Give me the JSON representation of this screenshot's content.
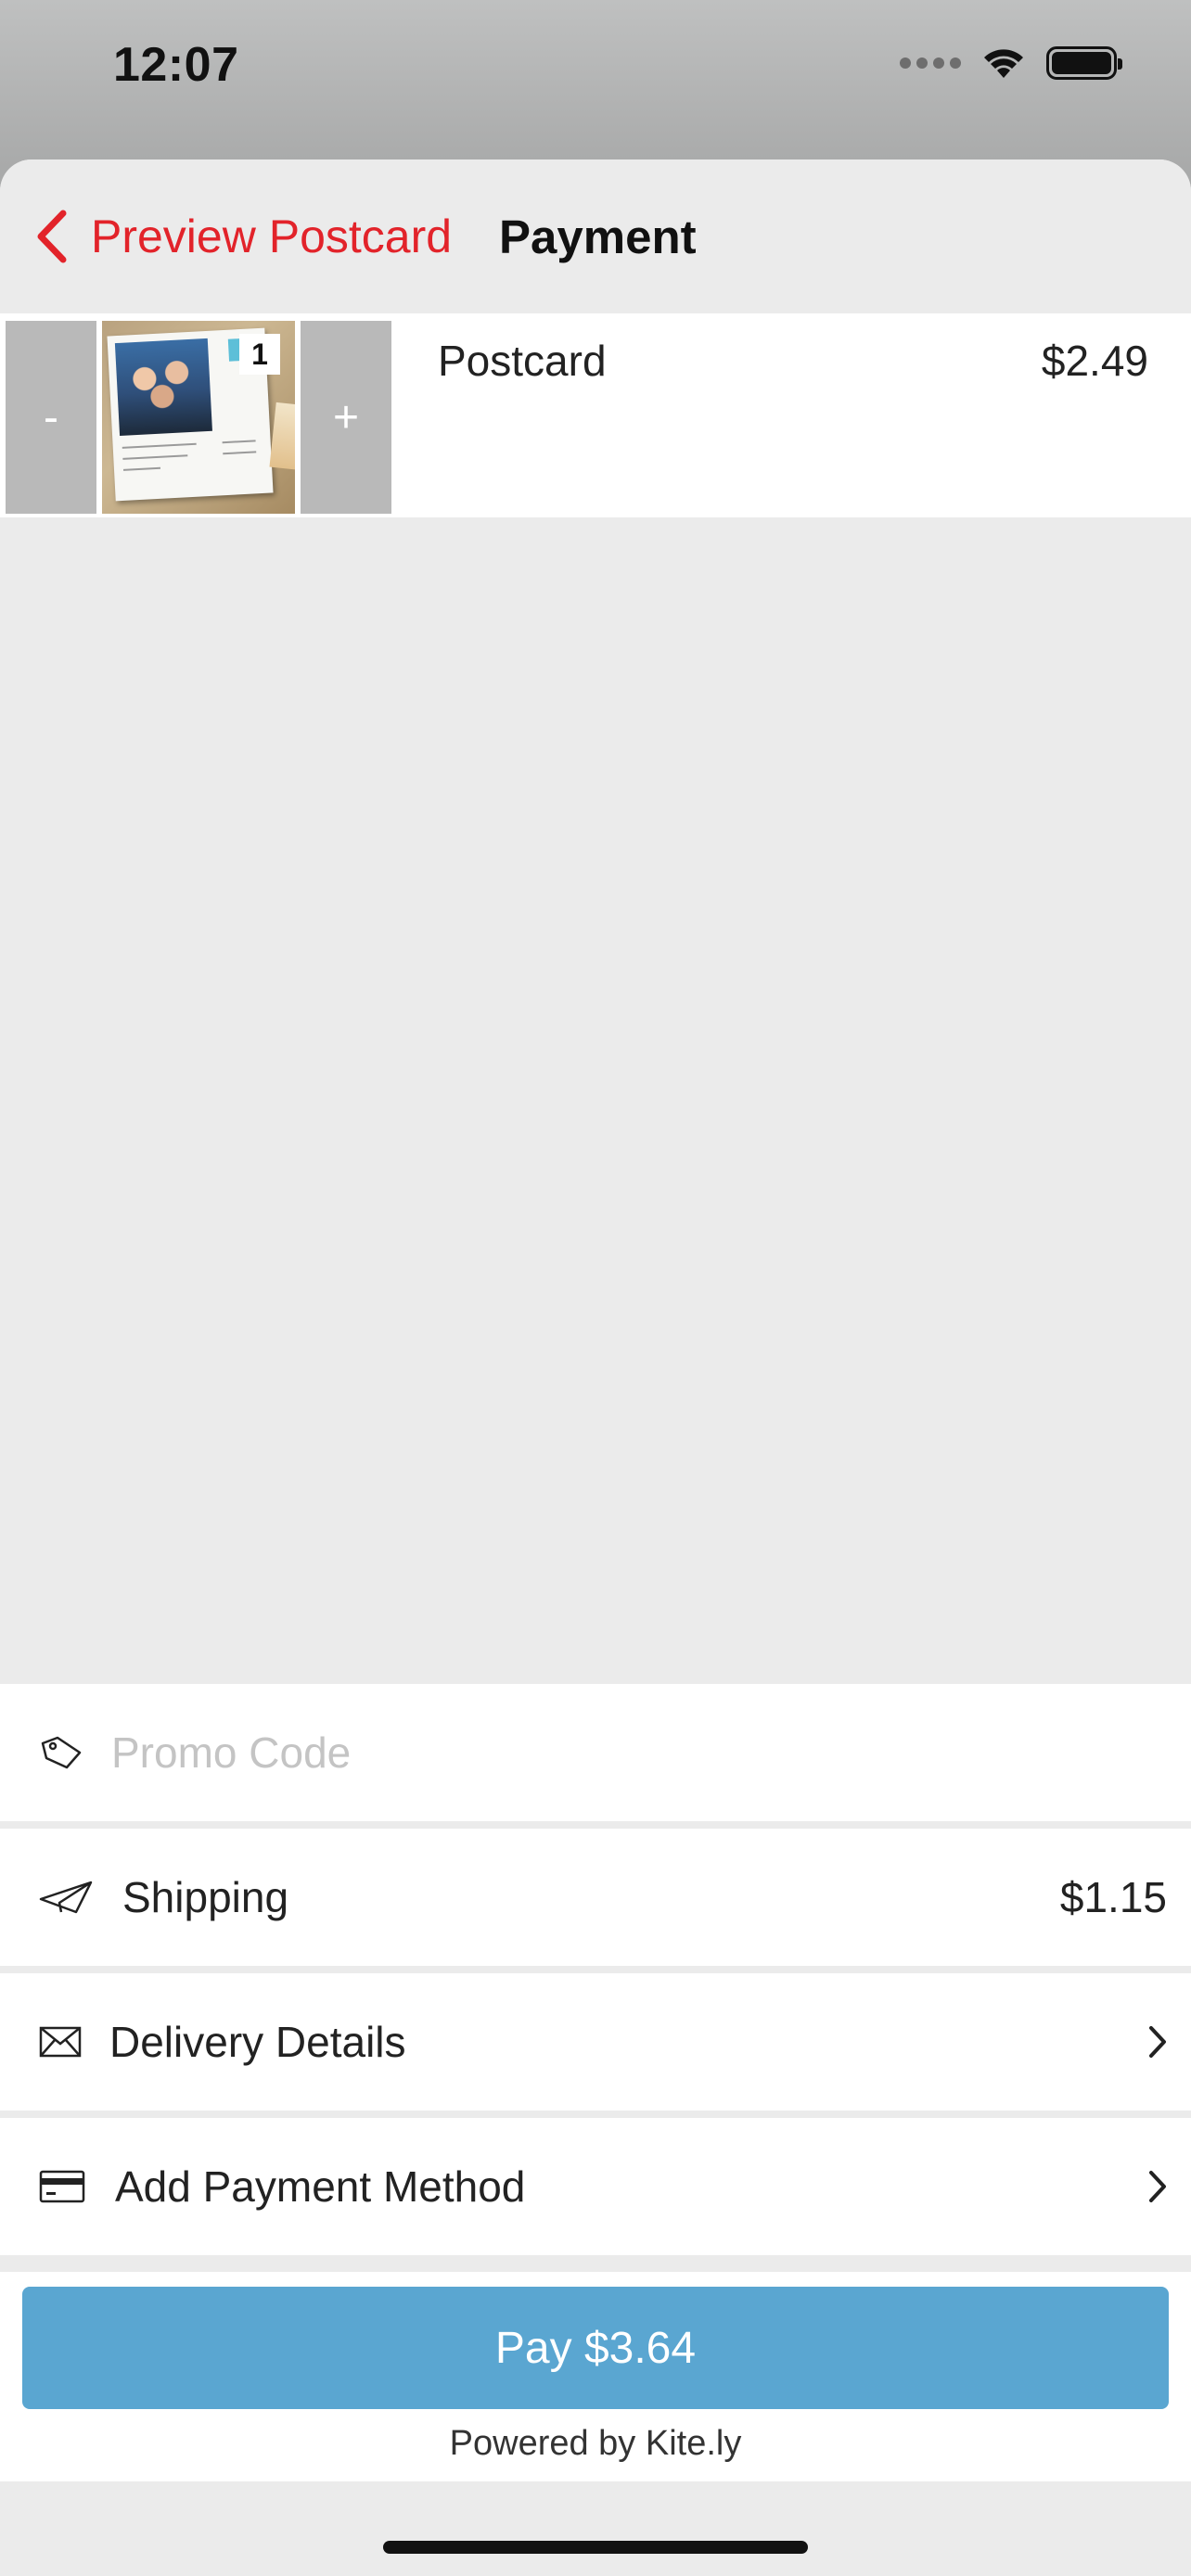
{
  "status_bar": {
    "time": "12:07"
  },
  "nav": {
    "back_label": "Preview Postcard",
    "title": "Payment"
  },
  "order_item": {
    "minus_label": "-",
    "plus_label": "+",
    "quantity": "1",
    "name": "Postcard",
    "price": "$2.49"
  },
  "promo": {
    "placeholder": "Promo Code"
  },
  "shipping": {
    "label": "Shipping",
    "value": "$1.15"
  },
  "delivery": {
    "label": "Delivery Details"
  },
  "payment_method": {
    "label": "Add Payment Method"
  },
  "pay": {
    "label": "Pay $3.64",
    "powered_by": "Powered by Kite.ly"
  },
  "colors": {
    "accent": "#e2232a",
    "pay_button": "#5aa6d1",
    "sheet_bg": "#ebebeb"
  }
}
